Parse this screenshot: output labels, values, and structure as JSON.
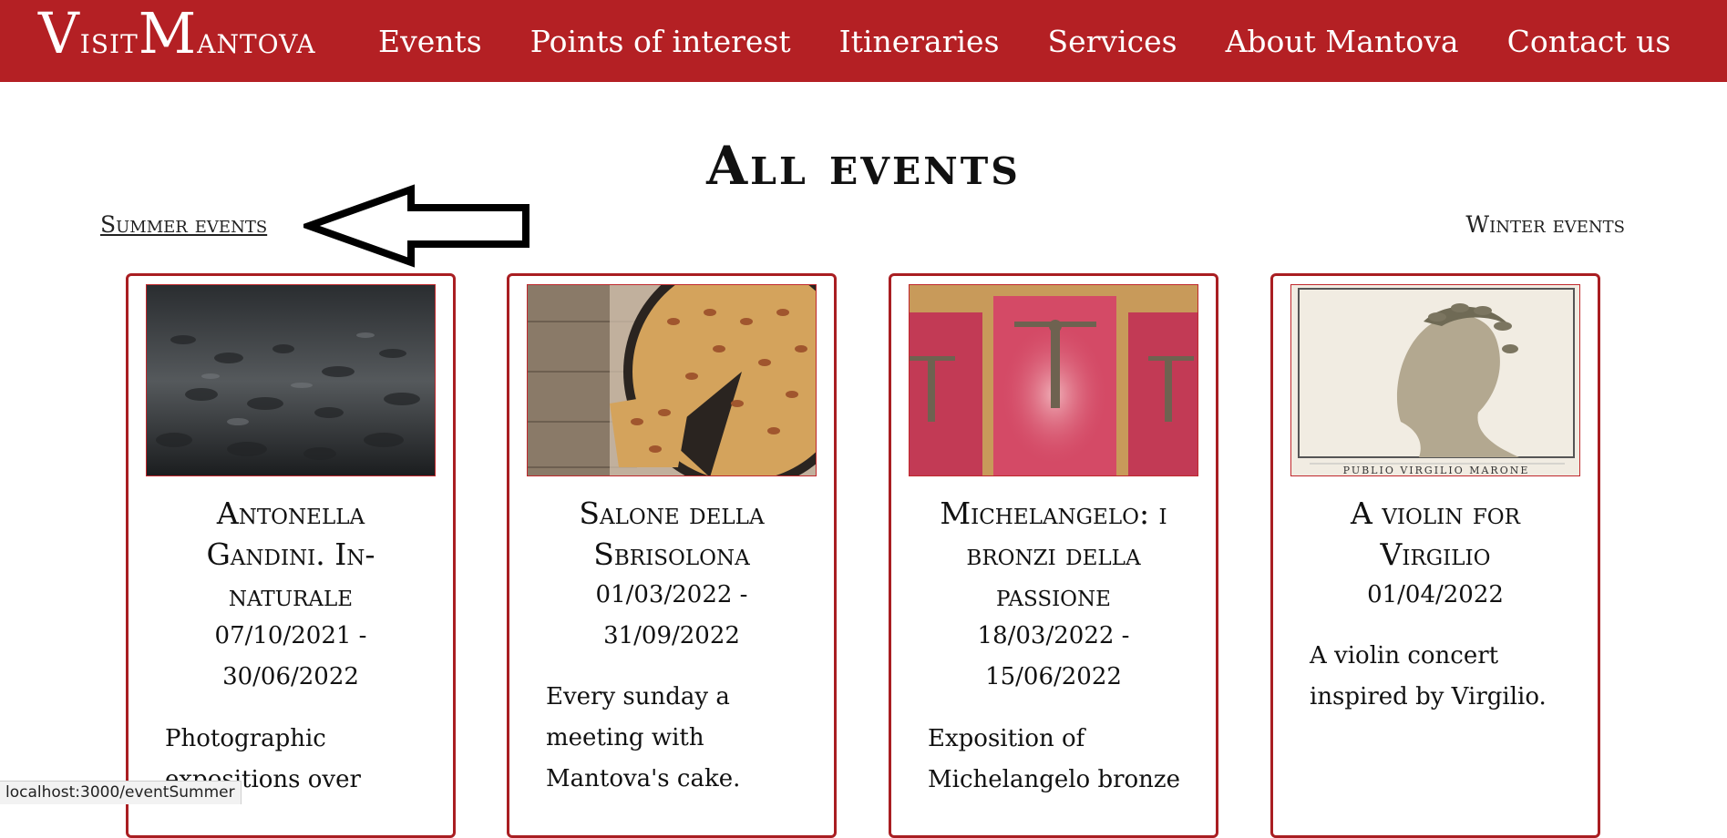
{
  "header": {
    "logo_big_v": "V",
    "logo_small_1": "isit",
    "logo_big_m": "M",
    "logo_small_2": "antova",
    "nav": [
      "Events",
      "Points of interest",
      "Itineraries",
      "Services",
      "About Mantova",
      "Contact us"
    ]
  },
  "page_title": "All events",
  "links": {
    "summer": "Summer events",
    "winter": "Winter events"
  },
  "cards": [
    {
      "title_lines": [
        "Antonella",
        "Gandini. In-",
        "naturale"
      ],
      "date_lines": [
        "07/10/2021 -",
        "30/06/2022"
      ],
      "desc_lines": [
        "Photographic",
        "expositions over"
      ],
      "image": "snowy-landscape-photo"
    },
    {
      "title_lines": [
        "Salone della",
        "Sbrisolona"
      ],
      "date_lines": [
        "01/03/2022 -",
        "31/09/2022"
      ],
      "desc_lines": [
        "Every sunday a",
        "meeting with",
        "Mantova's cake."
      ],
      "image": "almond-cake-photo"
    },
    {
      "title_lines": [
        "Michelangelo: i",
        "bronzi della",
        "passione"
      ],
      "date_lines": [
        "18/03/2022 -",
        "15/06/2022"
      ],
      "desc_lines": [
        "Exposition of",
        "Michelangelo bronze"
      ],
      "image": "bronze-crucifixes-photo"
    },
    {
      "title_lines": [
        "A violin for",
        "Virgilio"
      ],
      "date_lines": [
        "01/04/2022"
      ],
      "desc_lines": [
        "A violin concert",
        "inspired by Virgilio."
      ],
      "image": "virgil-engraving",
      "image_caption": "PUBLIO VIRGILIO MARONE"
    }
  ],
  "statusbar": "localhost:3000/eventSummer",
  "colors": {
    "brand": "#b42024",
    "card_border": "#a91e22"
  }
}
